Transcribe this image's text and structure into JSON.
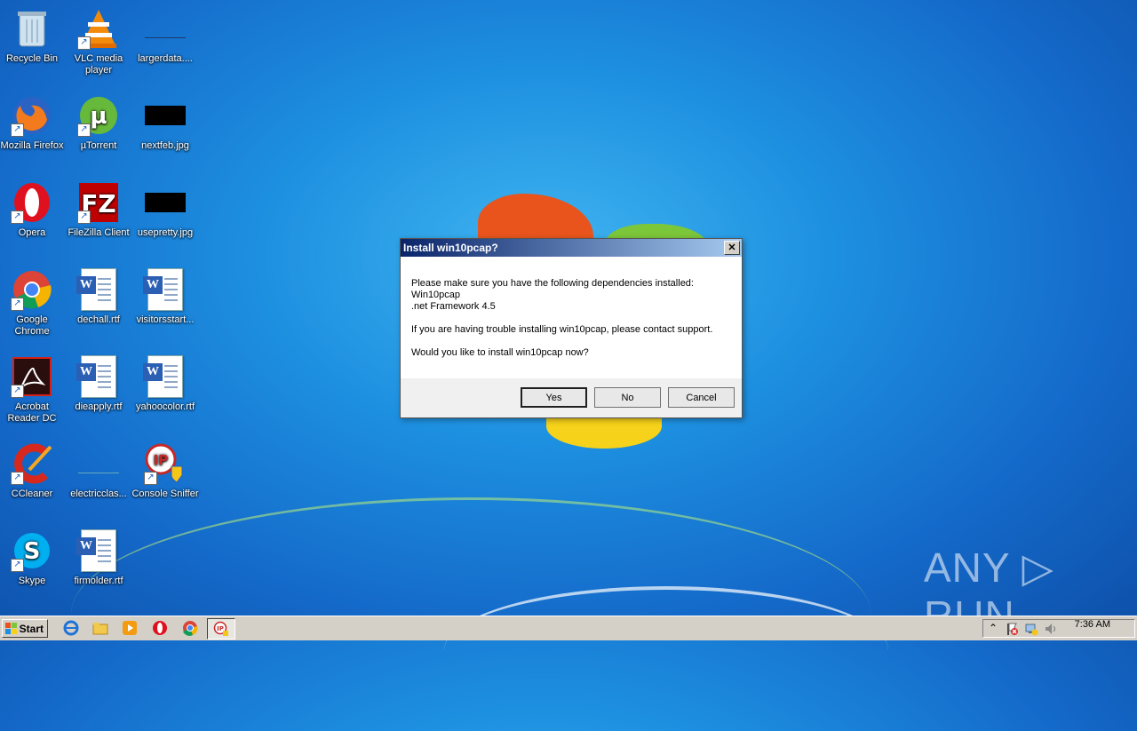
{
  "desktop": {
    "icons": [
      {
        "label": "Recycle Bin"
      },
      {
        "label": "VLC media player"
      },
      {
        "label": "largerdata...."
      },
      {
        "label": "Mozilla Firefox"
      },
      {
        "label": "µTorrent"
      },
      {
        "label": "nextfeb.jpg"
      },
      {
        "label": "Opera"
      },
      {
        "label": "FileZilla Client"
      },
      {
        "label": "usepretty.jpg"
      },
      {
        "label": "Google Chrome"
      },
      {
        "label": "dechall.rtf"
      },
      {
        "label": "visitorsstart..."
      },
      {
        "label": "Acrobat Reader DC"
      },
      {
        "label": "dieapply.rtf"
      },
      {
        "label": "yahoocolor.rtf"
      },
      {
        "label": "CCleaner"
      },
      {
        "label": "electricclas..."
      },
      {
        "label": "Console Sniffer"
      },
      {
        "label": "Skype"
      },
      {
        "label": "firmolder.rtf"
      }
    ]
  },
  "dialog": {
    "title": "Install win10pcap?",
    "close_glyph": "✕",
    "line1": "Please make sure you have the following dependencies installed:",
    "line2": "Win10pcap",
    "line3": ".net Framework 4.5",
    "line4": "If you are having trouble installing win10pcap, please contact support.",
    "line5": "Would you like to install win10pcap now?",
    "yes": "Yes",
    "no": "No",
    "cancel": "Cancel"
  },
  "taskbar": {
    "start": "Start",
    "clock": "7:36 AM",
    "tray_arrow": "⌃"
  },
  "watermark": "ANY ▷ RUN",
  "colors": {
    "titlebar_start": "#0a246a",
    "titlebar_end": "#a6caf0"
  }
}
